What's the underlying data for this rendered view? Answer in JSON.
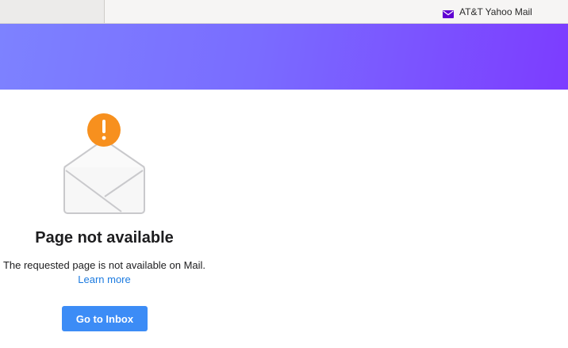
{
  "browser": {
    "tab_title": "AT&T Yahoo Mail",
    "tab_icon": "mail-envelope-icon"
  },
  "colors": {
    "header_gradient_start": "#7d82ff",
    "header_gradient_end": "#7c3cff",
    "alert_orange": "#f7901e",
    "link_blue": "#1c7be0",
    "button_blue": "#3c8cf6"
  },
  "error": {
    "icon": "open-envelope-alert-icon",
    "alert_glyph": "!",
    "title": "Page not available",
    "description": "The requested page is not available on Mail.",
    "learn_more_label": "Learn more",
    "button_label": "Go to Inbox"
  }
}
